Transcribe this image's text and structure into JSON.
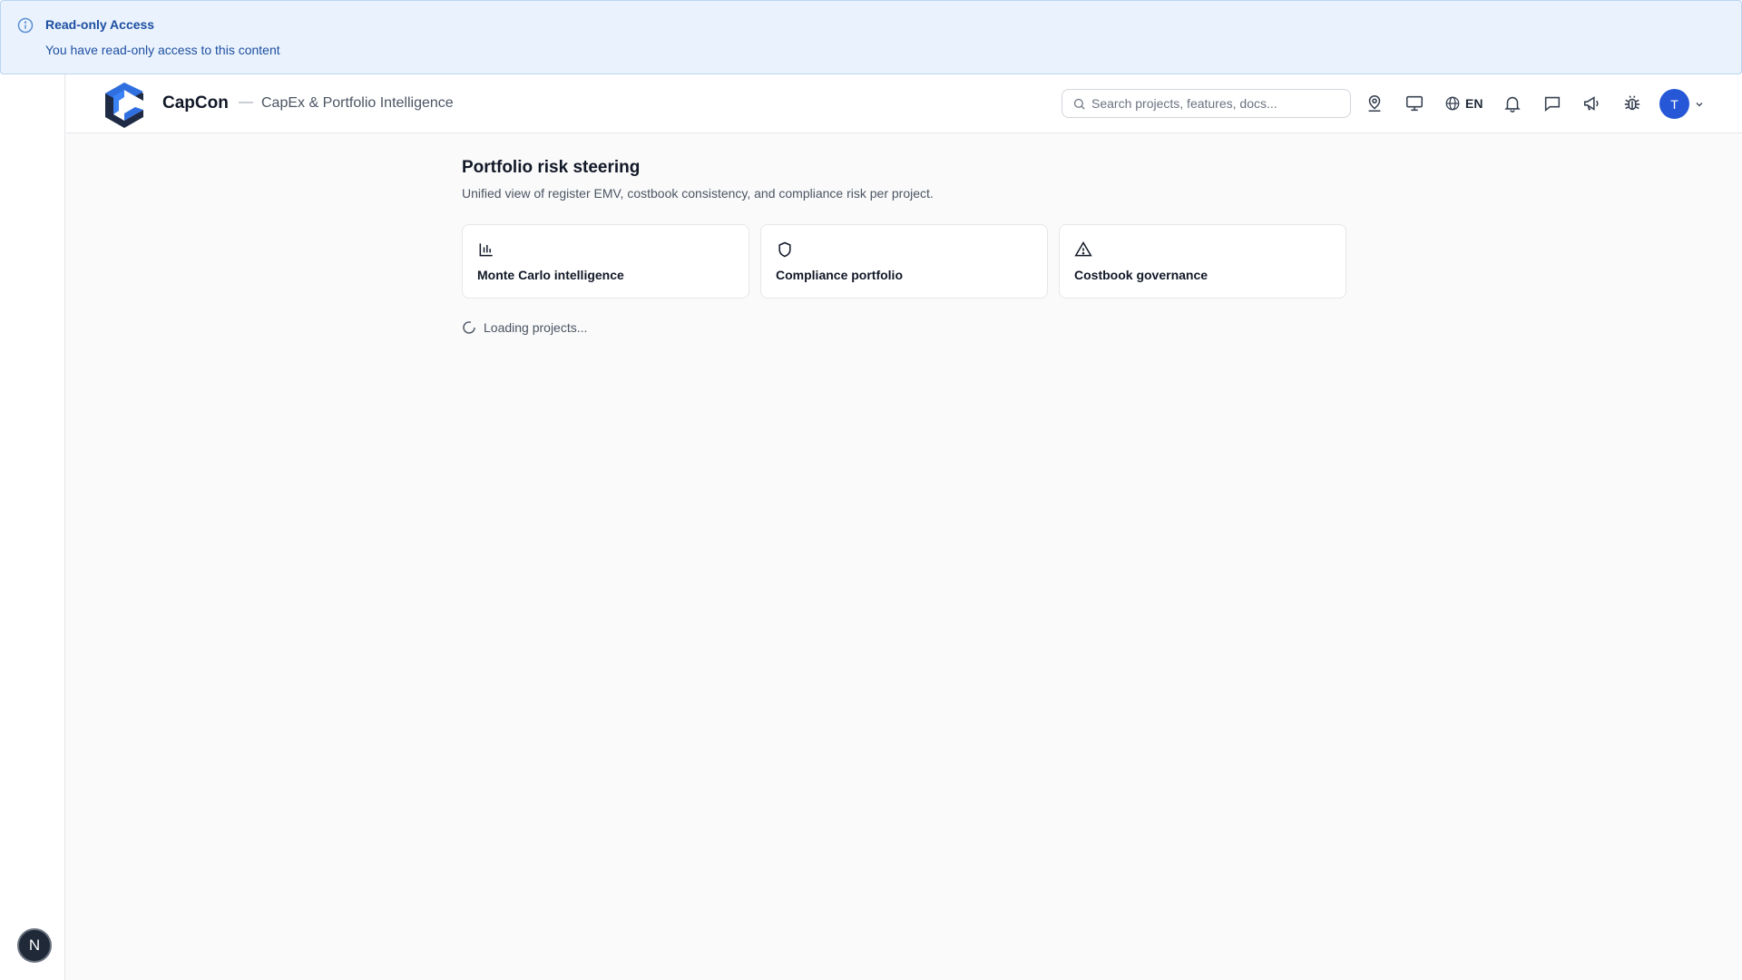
{
  "banner": {
    "title": "Read-only Access",
    "description": "You have read-only access to this content",
    "icon": "info-icon"
  },
  "header": {
    "brand": "CapCon",
    "separator": "—",
    "subtitle": "CapEx & Portfolio Intelligence",
    "search_placeholder": "Search projects, features, docs...",
    "language": "EN",
    "avatar_initial": "T",
    "icons": [
      "user-pin-icon",
      "monitor-icon",
      "globe-icon",
      "bell-icon",
      "chat-icon",
      "megaphone-icon",
      "bug-icon",
      "chevron-down-icon"
    ]
  },
  "main": {
    "title": "Portfolio risk steering",
    "description": "Unified view of register EMV, costbook consistency, and compliance risk per project.",
    "cards": [
      {
        "label": "Monte Carlo intelligence",
        "icon": "bar-chart-icon"
      },
      {
        "label": "Compliance portfolio",
        "icon": "shield-icon"
      },
      {
        "label": "Costbook governance",
        "icon": "warning-triangle-icon"
      }
    ],
    "loading_text": "Loading projects..."
  },
  "sidebar": {
    "badge": "N"
  },
  "colors": {
    "accent": "#2557d6",
    "banner_bg": "#eaf3fd",
    "banner_text": "#1e4fa1",
    "page_bg": "#fafafa"
  }
}
